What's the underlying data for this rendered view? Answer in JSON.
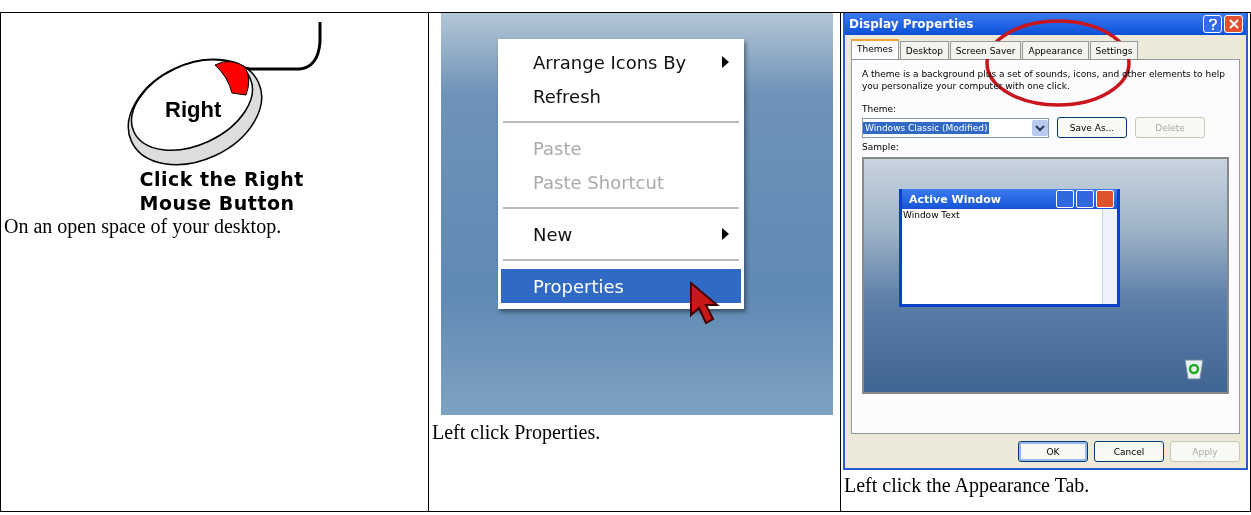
{
  "mouse_step": {
    "button_label": "Right",
    "instruction_lines": [
      "Click the Right",
      "Mouse Button"
    ],
    "caption": "On an open space of your desktop."
  },
  "menu_step": {
    "menu": [
      {
        "kind": "item",
        "label": "Arrange Icons By",
        "submenu": true,
        "disabled": false,
        "selected": false
      },
      {
        "kind": "item",
        "label": "Refresh",
        "submenu": false,
        "disabled": false,
        "selected": false
      },
      {
        "kind": "separator"
      },
      {
        "kind": "item",
        "label": "Paste",
        "submenu": false,
        "disabled": true,
        "selected": false
      },
      {
        "kind": "item",
        "label": "Paste Shortcut",
        "submenu": false,
        "disabled": true,
        "selected": false
      },
      {
        "kind": "separator"
      },
      {
        "kind": "item",
        "label": "New",
        "submenu": true,
        "disabled": false,
        "selected": false
      },
      {
        "kind": "separator"
      },
      {
        "kind": "item",
        "label": "Properties",
        "submenu": false,
        "disabled": false,
        "selected": true
      }
    ],
    "caption": "Left click Properties."
  },
  "dialog_step": {
    "title": "Display Properties",
    "tabs": [
      {
        "label": "Themes",
        "selected": true
      },
      {
        "label": "Desktop",
        "selected": false
      },
      {
        "label": "Screen Saver",
        "selected": false
      },
      {
        "label": "Appearance",
        "selected": false
      },
      {
        "label": "Settings",
        "selected": false
      }
    ],
    "description": "A theme is a background plus a set of sounds, icons, and other elements to help you personalize your computer with one click.",
    "theme_label": "Theme:",
    "theme_value": "Windows Classic (Modified)",
    "theme_buttons": [
      {
        "label": "Save As...",
        "disabled": false
      },
      {
        "label": "Delete",
        "disabled": true
      }
    ],
    "sample_label": "Sample:",
    "sample_window": {
      "title": "Active Window",
      "text": "Window Text"
    },
    "footer_buttons": [
      {
        "label": "OK",
        "disabled": false,
        "default": true
      },
      {
        "label": "Cancel",
        "disabled": false,
        "default": false
      },
      {
        "label": "Apply",
        "disabled": true,
        "default": false
      }
    ],
    "caption": "Left click the Appearance Tab."
  }
}
